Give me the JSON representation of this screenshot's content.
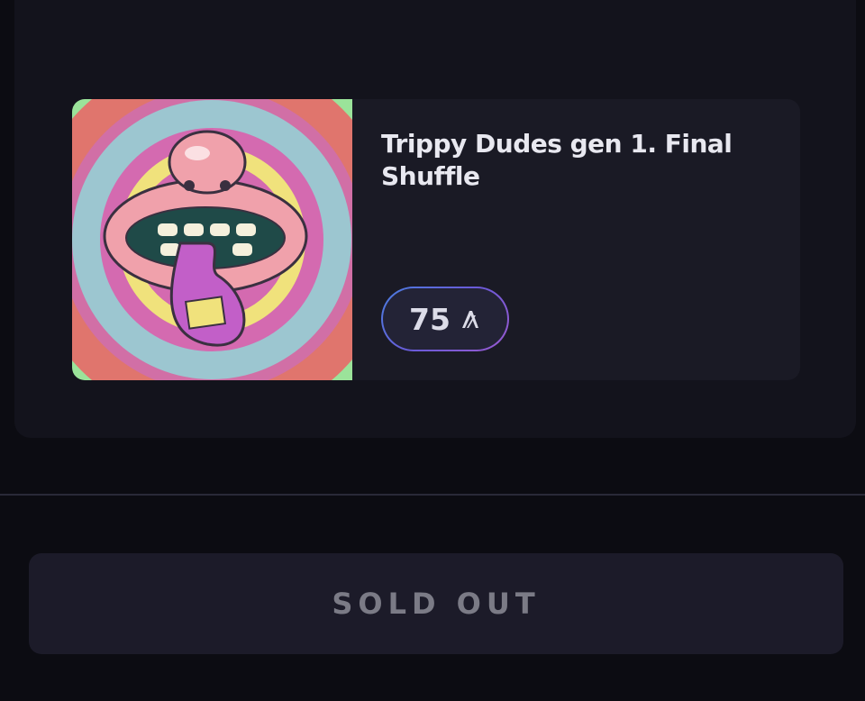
{
  "item": {
    "title": "Trippy Dudes gen 1. Final Shuffle",
    "price": "75",
    "currency_icon": "algorand-icon",
    "image_icon": "trippy-mouth-artwork"
  },
  "actions": {
    "sold_out_label": "SOLD OUT"
  },
  "colors": {
    "background": "#0c0c12",
    "card": "#13131c",
    "item_card": "#1a1a25",
    "price_border_start": "#4a7ee0",
    "price_border_end": "#9a5ad0",
    "sold_out_bg": "#1c1b29",
    "sold_out_text": "#7b7b86"
  }
}
